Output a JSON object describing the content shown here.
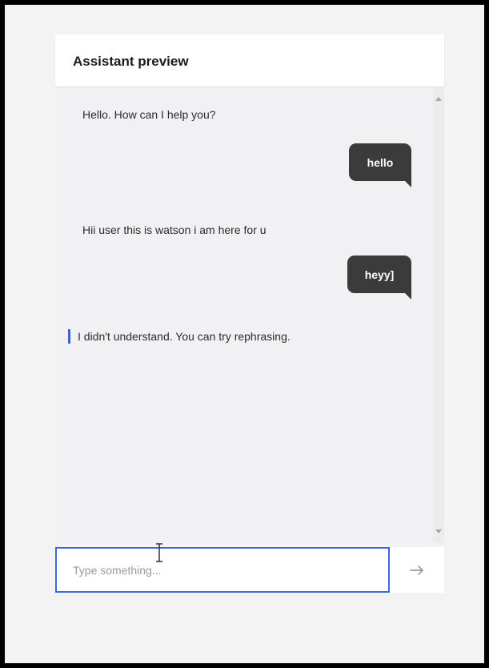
{
  "header": {
    "title": "Assistant preview"
  },
  "messages": [
    {
      "from": "bot",
      "text": "Hello. How can I help you?"
    },
    {
      "from": "user",
      "text": "hello"
    },
    {
      "from": "bot",
      "text": "Hii user this is watson i am here for u"
    },
    {
      "from": "user",
      "text": "heyy]"
    },
    {
      "from": "bot",
      "text": "I didn't understand. You can try rephrasing.",
      "style": "fallback"
    }
  ],
  "input": {
    "placeholder": "Type something...",
    "value": ""
  },
  "send": {
    "icon": "arrow-right-icon"
  },
  "colors": {
    "accent": "#3d6bd3",
    "user_bubble": "#3b3b3b",
    "chat_bg": "#f1f1f3"
  }
}
